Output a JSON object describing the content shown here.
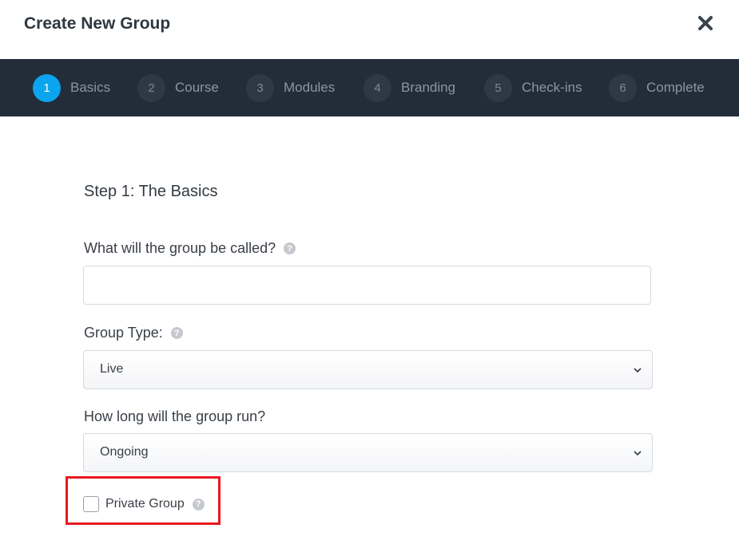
{
  "modal": {
    "title": "Create New Group",
    "close_icon": "close-icon"
  },
  "steps": [
    {
      "number": "1",
      "label": "Basics",
      "active": true
    },
    {
      "number": "2",
      "label": "Course",
      "active": false
    },
    {
      "number": "3",
      "label": "Modules",
      "active": false
    },
    {
      "number": "4",
      "label": "Branding",
      "active": false
    },
    {
      "number": "5",
      "label": "Check-ins",
      "active": false
    },
    {
      "number": "6",
      "label": "Complete",
      "active": false
    }
  ],
  "form": {
    "section_title": "Step 1: The Basics",
    "name_label": "What will the group be called?",
    "name_value": "",
    "name_placeholder": "",
    "type_label": "Group Type:",
    "type_value": "Live",
    "duration_label": "How long will the group run?",
    "duration_value": "Ongoing",
    "private_label": "Private Group",
    "private_checked": false,
    "help_icon": "question-circle-icon"
  },
  "colors": {
    "stepbar_bg": "#232d3a",
    "active_step": "#0aa4ef",
    "highlight_border": "#e8181f"
  }
}
